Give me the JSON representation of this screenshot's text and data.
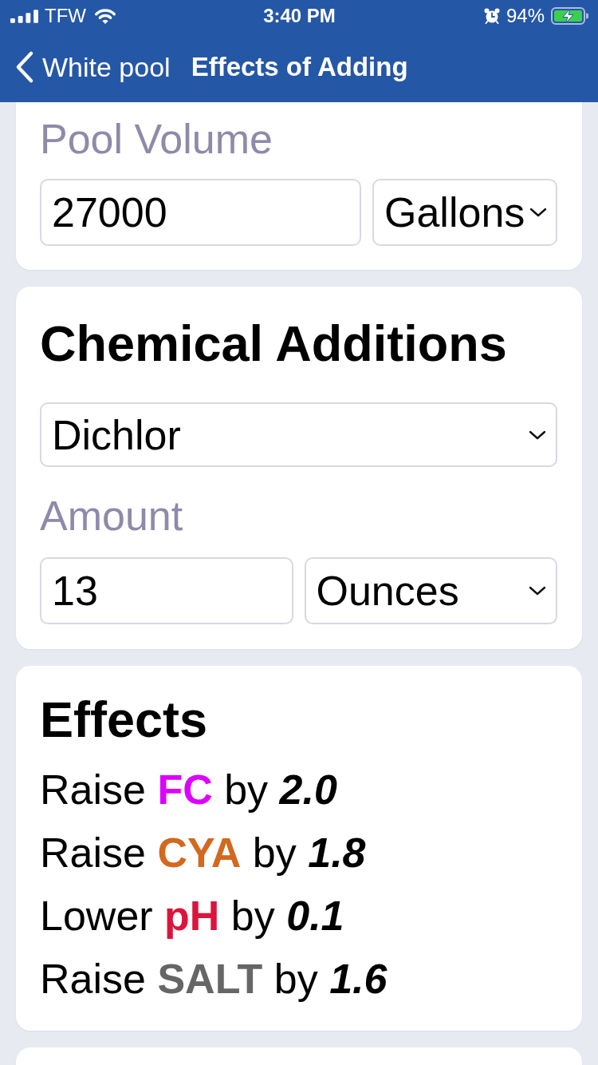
{
  "status_bar": {
    "carrier": "TFW",
    "time": "3:40 PM",
    "battery": "94%"
  },
  "nav_bar": {
    "back_label": "White pool",
    "title": "Effects of Adding"
  },
  "pool_volume": {
    "label": "Pool Volume",
    "value": "27000",
    "unit": "Gallons"
  },
  "chemical_additions": {
    "title": "Chemical Additions",
    "chemical": "Dichlor",
    "amount_label": "Amount",
    "amount": "13",
    "amount_unit": "Ounces"
  },
  "effects": {
    "title": "Effects",
    "items": [
      {
        "verb": "Raise",
        "chemical": "FC",
        "color": "#dd00ff",
        "preposition": "by",
        "amount": "2.0"
      },
      {
        "verb": "Raise",
        "chemical": "CYA",
        "color": "#d2691e",
        "preposition": "by",
        "amount": "1.8"
      },
      {
        "verb": "Lower",
        "chemical": "pH",
        "color": "#dc143c",
        "preposition": "by",
        "amount": "0.1"
      },
      {
        "verb": "Raise",
        "chemical": "SALT",
        "color": "#666666",
        "preposition": "by",
        "amount": "1.6"
      }
    ]
  }
}
